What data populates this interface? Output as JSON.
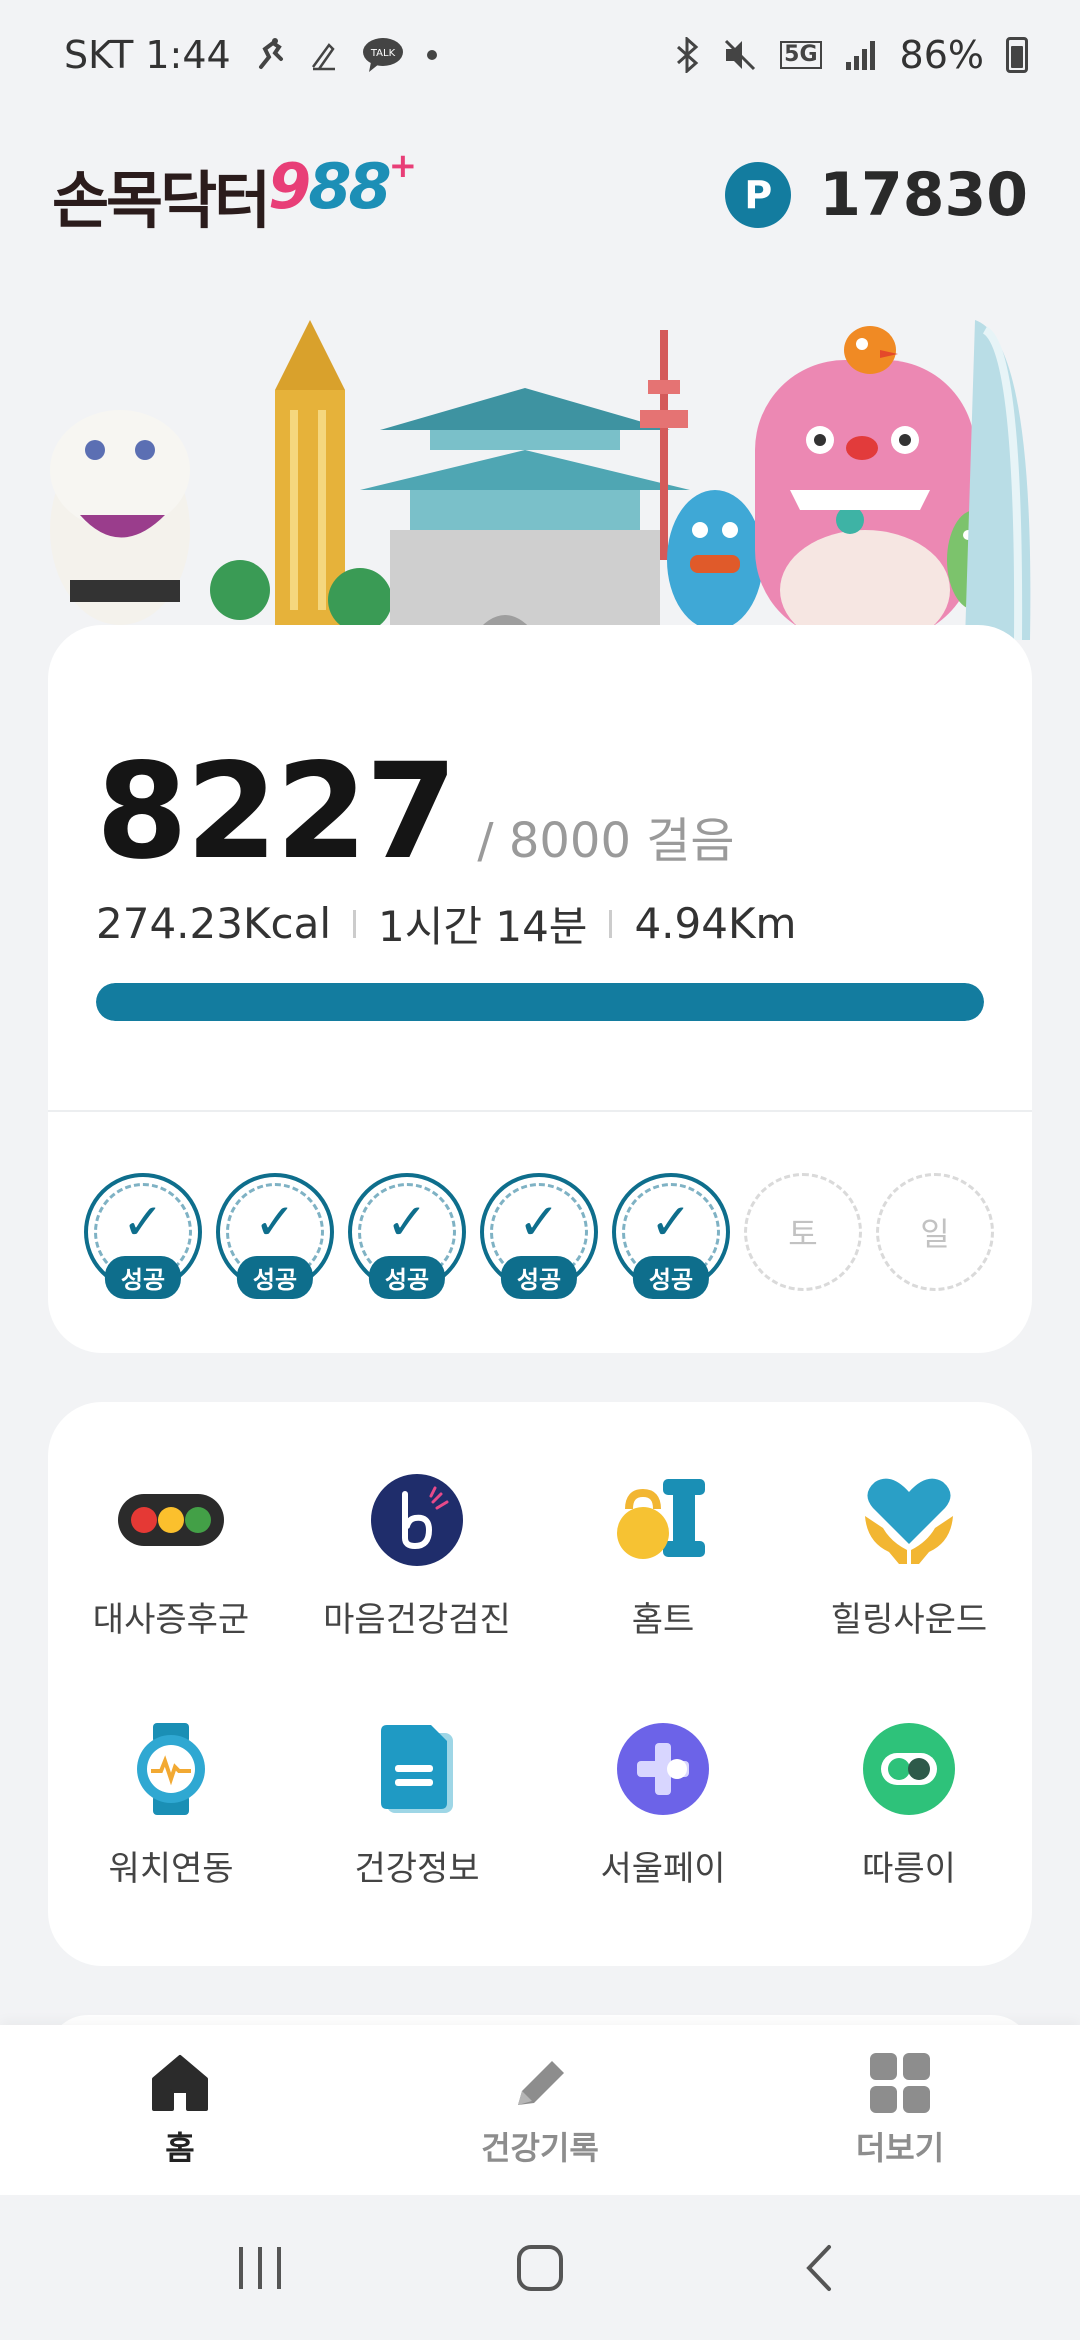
{
  "status_bar": {
    "carrier_time": "SKT 1:44",
    "talk_icon_text": "TALK",
    "network": "5G",
    "battery": "86%"
  },
  "header": {
    "logo_korean": "손목닥터",
    "logo_9": "9",
    "logo_88": "88",
    "logo_plus": "+",
    "point_badge": "P",
    "points": "17830"
  },
  "steps": {
    "count": "8227",
    "goal": "/ 8000 걸음",
    "calories": "274.23Kcal",
    "duration": "1시간 14분",
    "distance": "4.94Km",
    "progress": 1.0,
    "colors": {
      "accent": "#137c9f",
      "track": "#e6eef2"
    },
    "days": [
      {
        "state": "done",
        "label": "성공"
      },
      {
        "state": "done",
        "label": "성공"
      },
      {
        "state": "done",
        "label": "성공"
      },
      {
        "state": "done",
        "label": "성공"
      },
      {
        "state": "done",
        "label": "성공"
      },
      {
        "state": "todo",
        "label": "토"
      },
      {
        "state": "todo",
        "label": "일"
      }
    ]
  },
  "menu": [
    {
      "label": "대사증후군",
      "icon": "traffic-light-icon"
    },
    {
      "label": "마음건강검진",
      "icon": "mind-b-icon"
    },
    {
      "label": "홈트",
      "icon": "kettlebell-icon"
    },
    {
      "label": "힐링사운드",
      "icon": "heart-hands-icon"
    },
    {
      "label": "워치연동",
      "icon": "watch-icon"
    },
    {
      "label": "건강정보",
      "icon": "document-icon"
    },
    {
      "label": "서울페이",
      "icon": "seoul-pay-icon"
    },
    {
      "label": "따릉이",
      "icon": "bike-toggle-icon"
    }
  ],
  "bottom_nav": [
    {
      "label": "홈",
      "icon": "home-icon",
      "active": true
    },
    {
      "label": "건강기록",
      "icon": "pencil-icon",
      "active": false
    },
    {
      "label": "더보기",
      "icon": "grid-icon",
      "active": false
    }
  ]
}
